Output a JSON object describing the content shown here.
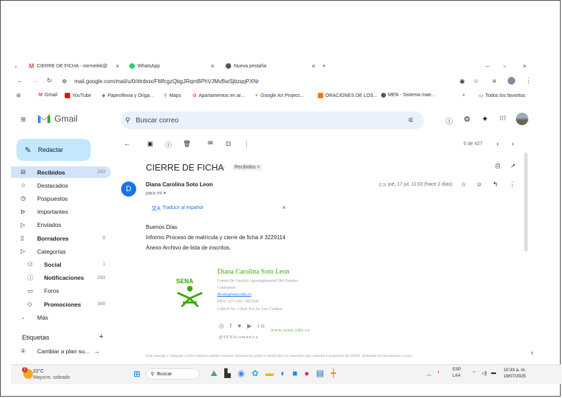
{
  "browser": {
    "tabs": [
      {
        "label": "CIERRE DE FICHA - normelek@",
        "active": true
      },
      {
        "label": "WhatsApp",
        "active": false
      },
      {
        "label": "Nueva pestaña",
        "active": false
      }
    ],
    "url": "mail.google.com/mail/u/0/#inbox/FMfcgzQbgJRqmBPhVJMvBwSjbzqqPXNr",
    "bookmarks": [
      "Gmail",
      "YouTube",
      "Papiroflexia y Origa...",
      "Maps",
      "Apartamentos en ar...",
      "Google Art Project...",
      "ORACIONES DE LOS...",
      "MEN - Sistema mae..."
    ],
    "bookmarks_more": "»",
    "all_bookmarks": "Todos los favoritos"
  },
  "gmail": {
    "logo_text": "Gmail",
    "search_placeholder": "Buscar correo",
    "compose": "Redactar",
    "nav": [
      {
        "label": "Recibidos",
        "count": "243",
        "bold": true,
        "icon": "inbox-icon"
      },
      {
        "label": "Destacados",
        "count": "",
        "bold": false,
        "icon": "star-icon"
      },
      {
        "label": "Pospuestos",
        "count": "",
        "bold": false,
        "icon": "clock-icon"
      },
      {
        "label": "Importantes",
        "count": "",
        "bold": false,
        "icon": "important-icon"
      },
      {
        "label": "Enviados",
        "count": "",
        "bold": false,
        "icon": "send-icon"
      },
      {
        "label": "Borradores",
        "count": "8",
        "bold": true,
        "icon": "draft-icon"
      },
      {
        "label": "Categorías",
        "count": "",
        "bold": false,
        "icon": "label-icon"
      }
    ],
    "categories": [
      {
        "label": "Social",
        "count": "1",
        "bold": true,
        "icon": "people-icon"
      },
      {
        "label": "Notificaciones",
        "count": "283",
        "bold": true,
        "icon": "info-icon"
      },
      {
        "label": "Foros",
        "count": "",
        "bold": false,
        "icon": "forum-icon"
      },
      {
        "label": "Promociones",
        "count": "348",
        "bold": true,
        "icon": "tag-icon"
      }
    ],
    "more": "Más",
    "labels_title": "Etiquetas",
    "label_item": "Cambiar a plan su...",
    "pagination": "6 de 427"
  },
  "email": {
    "subject": "CIERRE DE FICHA",
    "folder_chip": "Recibidos ×",
    "avatar_letter": "D",
    "sender": "Diana Carolina Soto Leon",
    "to": "para mí ▾",
    "date": "jue, 17 jul, 11:03 (hace 2 días)",
    "translate": "Traducir al español",
    "body": [
      "Buenos Días",
      "Informo Proceso de matrícula y cierre de ficha # 3229114",
      "Anexo Archivo de lista de inscritos."
    ],
    "signature": {
      "name": "Diana Carolina Soto Leon",
      "line1": "Centro De Gestión Agroempresarial Del Oriente -",
      "line2": "Contratista",
      "email": "dcsoto@sena.edu.co",
      "phone": "PBX:+(57) 601 7461500",
      "address": "Calle 8 No. 2 Este Por Av. Las Cuadras",
      "website": "www.sena.edu.co",
      "handle": "@SENAcomunica",
      "logo": "SENA"
    },
    "disclaimer": "Este mensaje y cualquier archivo adjunto pueden contener información pública clasificada y/o reservada bajo custodia o propiedad del SENA, destinada exclusivamente a su(s)"
  },
  "taskbar": {
    "weather_temp": "22°C",
    "weather_desc": "Mayorm. soleado",
    "search": "Buscar",
    "lang1": "ESP",
    "lang2": "LAA",
    "time": "10:33 a. m.",
    "date": "19/07/2025",
    "badge": "2"
  },
  "colors": {
    "gmail_red": "#ea4335",
    "compose_bg": "#c2e7ff",
    "selected_nav": "#d3e3fd",
    "sena_green": "#39a900"
  }
}
